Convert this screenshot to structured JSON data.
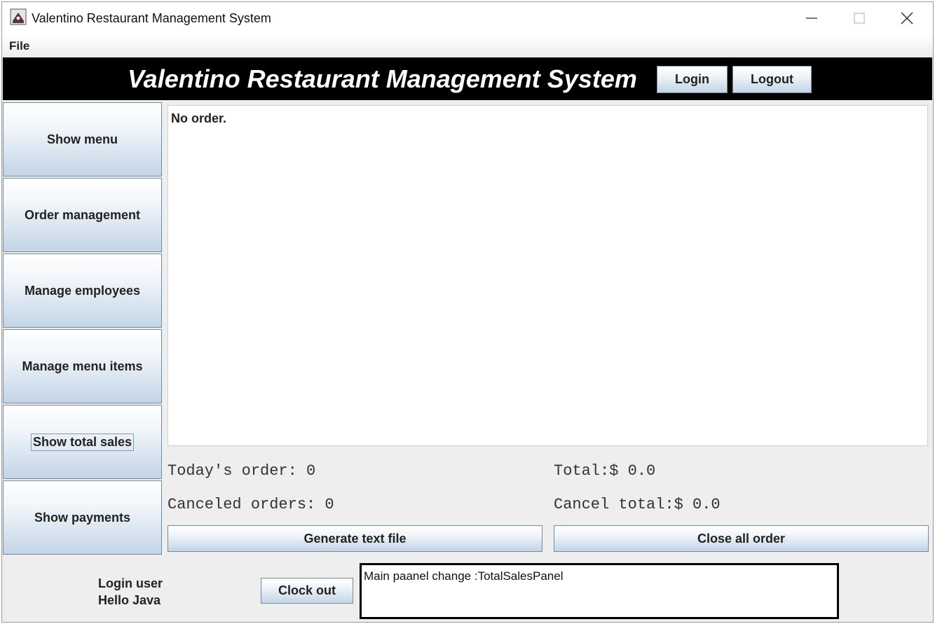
{
  "window": {
    "title": "Valentino Restaurant Management System",
    "icon": "restaurant-app-icon",
    "controls": [
      "minimize-icon",
      "maximize-icon",
      "close-icon"
    ]
  },
  "menu": {
    "file": "File"
  },
  "header": {
    "title": "Valentino Restaurant Management System",
    "login_label": "Login",
    "logout_label": "Logout"
  },
  "sidebar": {
    "items": [
      {
        "label": "Show menu"
      },
      {
        "label": "Order management"
      },
      {
        "label": "Manage employees"
      },
      {
        "label": "Manage menu items"
      },
      {
        "label": "Show total sales"
      },
      {
        "label": "Show payments"
      }
    ]
  },
  "main": {
    "content_text": "No order.",
    "todays_order": "Today's order: 0",
    "total": "Total:$ 0.0",
    "canceled_orders": "Canceled orders: 0",
    "cancel_total": "Cancel total:$ 0.0",
    "generate_label": "Generate text file",
    "close_all_label": "Close all order"
  },
  "footer": {
    "login_user_label": "Login user",
    "user_name": "Hello Java",
    "clock_out_label": "Clock out",
    "log_text": "Main paanel change :TotalSalesPanel"
  },
  "colors": {
    "header_bg": "#000000",
    "header_text": "#ffffff",
    "window_bg": "#eeeeee",
    "button_gradient_top": "#ffffff",
    "button_gradient_bottom": "#c3d4e6"
  }
}
